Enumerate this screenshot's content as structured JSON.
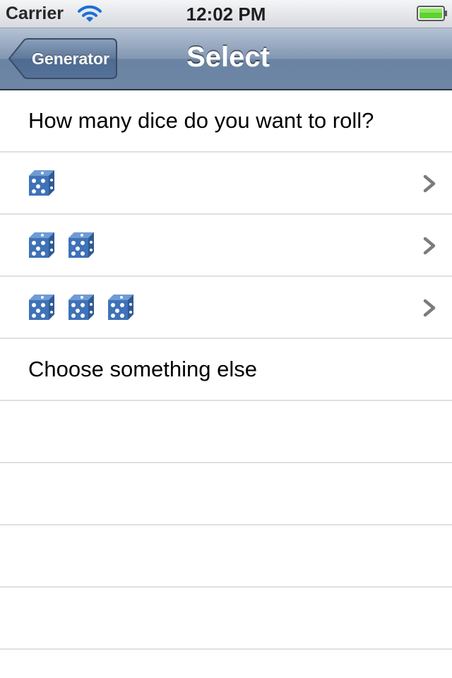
{
  "status_bar": {
    "carrier": "Carrier",
    "time": "12:02 PM",
    "wifi_icon": "wifi-icon",
    "battery_icon": "battery-icon",
    "battery_color": "#5fd12f"
  },
  "nav_bar": {
    "back_label": "Generator",
    "title": "Select",
    "tint": "#6d86a5"
  },
  "table": {
    "prompt": "How many dice do you want to roll?",
    "options": [
      {
        "dice_count": 1,
        "icon": "die-icon",
        "accessory": "chevron-right-icon"
      },
      {
        "dice_count": 2,
        "icon": "die-icon",
        "accessory": "chevron-right-icon"
      },
      {
        "dice_count": 3,
        "icon": "die-icon",
        "accessory": "chevron-right-icon"
      }
    ],
    "other_label": "Choose something else",
    "die_color": "#3f72b8",
    "separator_color": "#e0e0e0"
  }
}
